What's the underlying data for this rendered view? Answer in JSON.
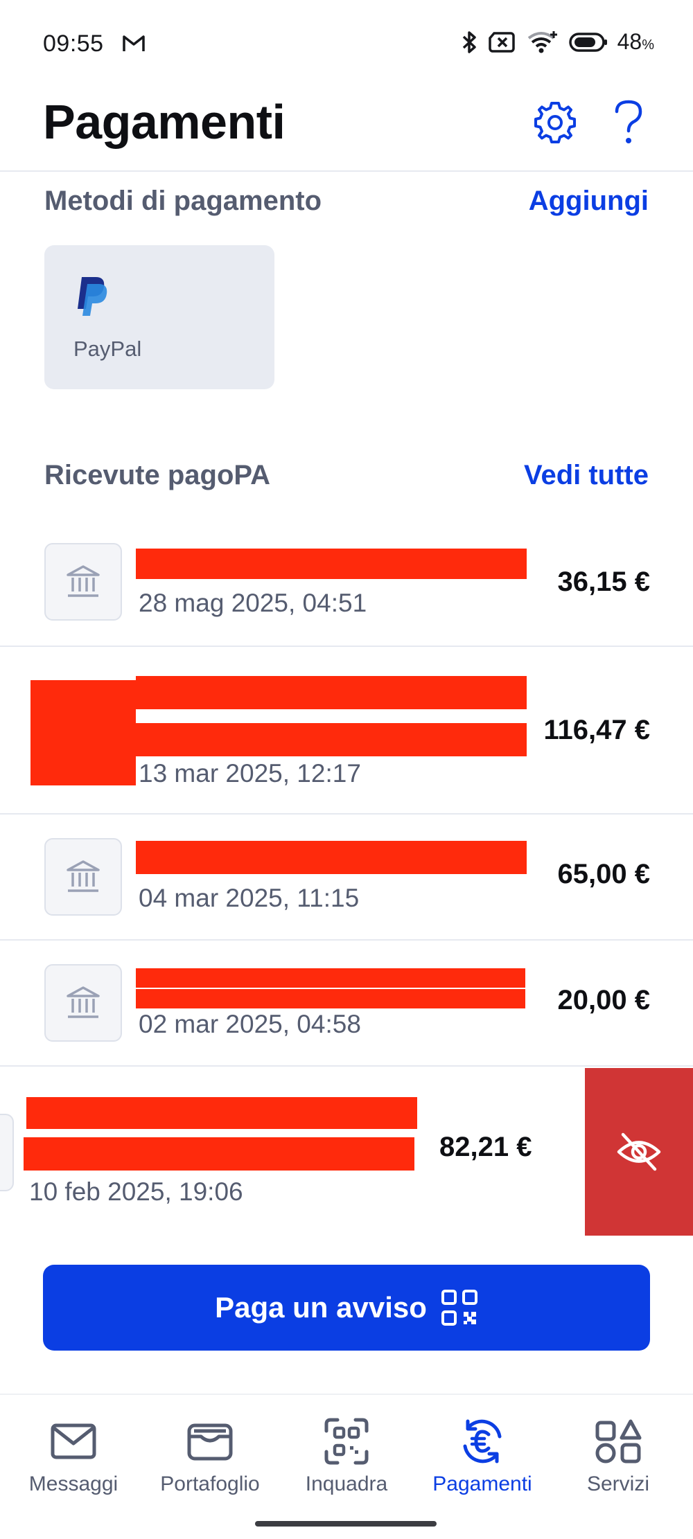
{
  "status_bar": {
    "time": "09:55",
    "battery_percent": "48",
    "battery_unit": "%"
  },
  "header": {
    "title": "Pagamenti",
    "icons": [
      "gear-icon",
      "help-icon"
    ]
  },
  "payment_methods": {
    "title": "Metodi di pagamento",
    "action_label": "Aggiungi",
    "methods": [
      {
        "label": "PayPal",
        "icon": "paypal-logo"
      }
    ]
  },
  "receipts": {
    "title": "Ricevute pagoPA",
    "action_label": "Vedi tutte",
    "items": [
      {
        "date": "28 mag 2025, 04:51",
        "amount": "36,15 €",
        "icon": "bank-icon"
      },
      {
        "date": "13 mar 2025, 12:17",
        "amount": "116,47 €",
        "icon": "bank-icon"
      },
      {
        "date": "04 mar 2025, 11:15",
        "amount": "65,00 €",
        "icon": "bank-icon"
      },
      {
        "date": "02 mar 2025, 04:58",
        "amount": "20,00 €",
        "icon": "bank-icon"
      },
      {
        "date": "10 feb 2025, 19:06",
        "amount": "82,21 €",
        "icon": "bank-icon"
      }
    ],
    "swipe_action_icon": "eye-slash-icon"
  },
  "pay_button": {
    "label": "Paga un avviso",
    "icon": "qr-code-icon"
  },
  "tab_bar": {
    "tabs": [
      {
        "label": "Messaggi",
        "icon": "envelope-icon",
        "active": false
      },
      {
        "label": "Portafoglio",
        "icon": "wallet-icon",
        "active": false
      },
      {
        "label": "Inquadra",
        "icon": "qr-scan-icon",
        "active": false
      },
      {
        "label": "Pagamenti",
        "icon": "euro-cycle-icon",
        "active": true
      },
      {
        "label": "Servizi",
        "icon": "shapes-icon",
        "active": false
      }
    ]
  },
  "colors": {
    "accent": "#0b3ee3",
    "text_primary": "#0e0f13",
    "text_secondary": "#555c70",
    "card_bg": "#e8ebf2",
    "danger": "#d03535",
    "redaction": "#ff2a0c"
  }
}
